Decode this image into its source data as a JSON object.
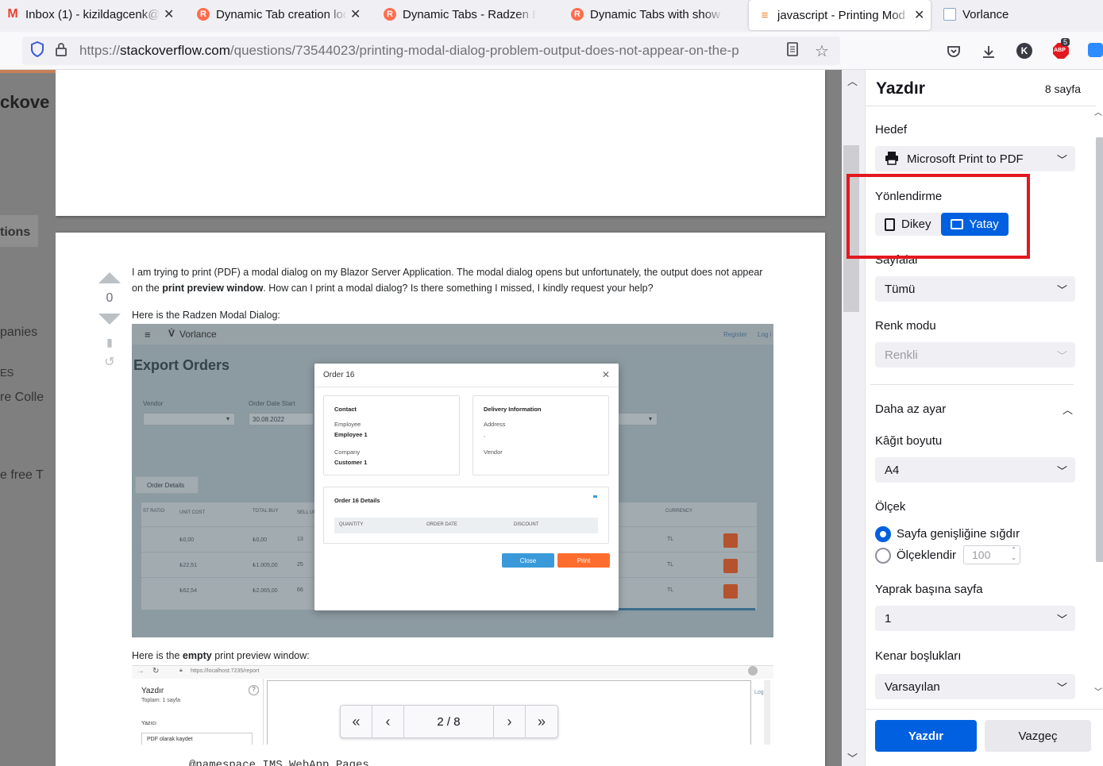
{
  "tabs": [
    {
      "title": "Inbox (1) - kizildagcenk@",
      "icon": "gmail-icon"
    },
    {
      "title": "Dynamic Tab creation loo",
      "icon": "radzen-icon"
    },
    {
      "title": "Dynamic Tabs - Radzen B",
      "icon": "radzen-icon"
    },
    {
      "title": "Dynamic Tabs with show",
      "icon": "radzen-icon"
    },
    {
      "title": "javascript - Printing Mod",
      "icon": "stackoverflow-icon",
      "active": true
    },
    {
      "title": "Vorlance",
      "icon": "document-icon"
    }
  ],
  "url": {
    "scheme": "https://",
    "host": "stackoverflow.com",
    "path": "/questions/73544023/printing-modal-dialog-problem-output-does-not-appear-on-the-p"
  },
  "toolbar": {
    "abp_badge": "5",
    "abp_label": "ABP",
    "account_letter": "K"
  },
  "so_sidebar": {
    "logo_fragment": "ckove",
    "items": [
      "tions",
      "panies",
      "ES",
      "re Colle",
      "e free T"
    ]
  },
  "post": {
    "vote_count": "0",
    "body_part1": "I am trying to print (PDF) a modal dialog on my Blazor Server Application. The modal dialog opens but unfortunately, the output does not appear on the ",
    "body_bold": "print preview window",
    "body_part2": ". How can I print a modal dialog? Is there something I missed, I kindly request your help?",
    "intro1": "Here is the Radzen Modal Dialog:",
    "intro2_part1": "Here is the ",
    "intro2_bold": "empty",
    "intro2_part2": " print preview window:",
    "code_fragment": "@namespace IMS.WebApp.Pages"
  },
  "embedded1": {
    "app_name": "Vorlance",
    "register": "Register",
    "login": "Log i",
    "page_heading": "Export Orders",
    "vendor_label": "Vendor",
    "date_label": "Order Date Start",
    "date_value": "30.08.2022",
    "tab_label": "Order Details",
    "col_headers": [
      "ST RATIO",
      "UNIT COST",
      "TOTAL BUY",
      "SELL UN",
      "CURRENCY"
    ],
    "rows": [
      [
        "₺0,00",
        "₺0,00",
        "13",
        "TL"
      ],
      [
        "₺22,51",
        "₺1.005,00",
        "25",
        "TL"
      ],
      [
        "₺62,54",
        "₺2.065,00",
        "66",
        "TL"
      ]
    ],
    "modal": {
      "title": "Order 16",
      "contact_title": "Contact",
      "employee_label": "Employee",
      "employee_value": "Employee 1",
      "company_label": "Company",
      "company_value": "Customer 1",
      "delivery_title": "Delivery Information",
      "address_label": "Address",
      "address_value": ",",
      "vendor_label": "Vendor",
      "details_title": "Order 16 Details",
      "detail_cols": [
        "QUANTITY",
        "ORDER DATE",
        "DISCOUNT"
      ],
      "close_label": "Close",
      "print_label": "Print"
    }
  },
  "embedded2": {
    "url": "https://localhost:7235/report",
    "title": "Yazdır",
    "subtitle": "Toplam: 1 sayfa",
    "printer_label": "Yazıcı",
    "printer_value": "PDF olarak kaydet",
    "login": "Log in"
  },
  "pager": {
    "label": "2 / 8"
  },
  "print_panel": {
    "title": "Yazdır",
    "page_count": "8 sayfa",
    "destination_label": "Hedef",
    "destination_value": "Microsoft Print to PDF",
    "orientation_label": "Yönlendirme",
    "portrait": "Dikey",
    "landscape": "Yatay",
    "pages_label": "Sayfalar",
    "pages_value": "Tümü",
    "color_label": "Renk modu",
    "color_value": "Renkli",
    "less_settings": "Daha az ayar",
    "paper_label": "Kâğıt boyutu",
    "paper_value": "A4",
    "scale_label": "Ölçek",
    "scale_fit": "Sayfa genişliğine sığdır",
    "scale_custom": "Ölçeklendir",
    "scale_value": "100",
    "per_sheet_label": "Yaprak başına sayfa",
    "per_sheet_value": "1",
    "margins_label": "Kenar boşlukları",
    "margins_value": "Varsayılan",
    "print_button": "Yazdır",
    "cancel_button": "Vazgeç"
  },
  "colors": {
    "accent": "#0060df",
    "highlight_box": "#e3181e",
    "so_orange": "#f48024"
  }
}
